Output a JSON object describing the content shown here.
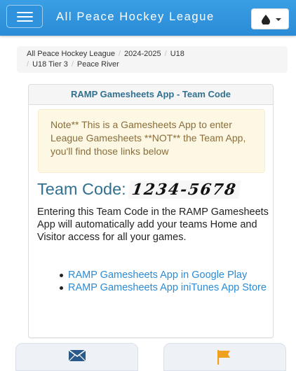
{
  "navbar": {
    "title": "All Peace Hockey League",
    "menu_icon": "hamburger-icon",
    "theme_icon": "droplet-icon"
  },
  "breadcrumb": {
    "items": [
      "All Peace Hockey League",
      "2024-2025",
      "U18",
      "U18 Tier 3",
      "Peace River"
    ],
    "separator": "/"
  },
  "panel": {
    "heading": "RAMP Gamesheets App - Team Code",
    "note": "Note** This is a Gamesheets App to enter League Gamesheets **NOT** the Team App, you'll find those links below",
    "team_code_label": "Team Code:",
    "team_code_value": "1234-5678",
    "description": "Entering this Team Code in the RAMP Gamesheets App will automatically add your teams Home and Visitor access for all your games.",
    "links": [
      "RAMP Gamesheets App in Google Play",
      "RAMP Gamesheets App iniTunes App Store"
    ]
  },
  "bottom_tiles": {
    "left_icon": "envelope-icon",
    "right_icon": "flag-icon"
  },
  "colors": {
    "navbar": "#2a8bd6",
    "heading": "#31708f",
    "note_bg": "#fcf8e3",
    "note_text": "#8a6d3b",
    "link": "#2a8bd6",
    "flag": "#f0a020"
  }
}
